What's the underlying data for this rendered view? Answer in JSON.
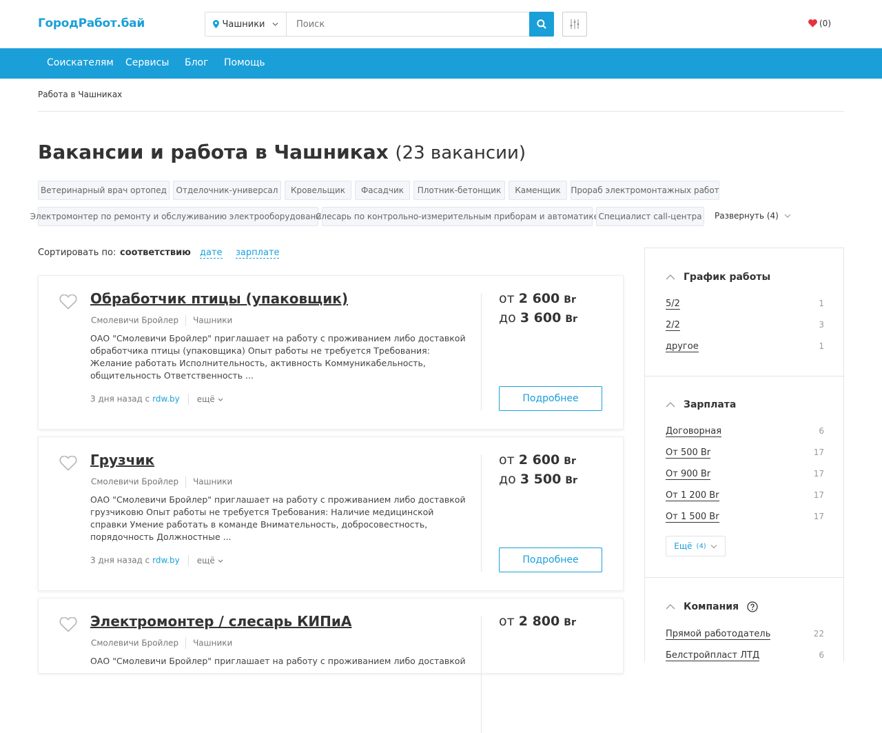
{
  "header": {
    "logo": "ГородРабот.бай",
    "city": "Чашники",
    "search_placeholder": "Поиск",
    "favorites_count": "(0)"
  },
  "nav": [
    "Соискателям",
    "Сервисы",
    "Блог",
    "Помощь"
  ],
  "breadcrumb": "Работа в Чашниках",
  "page": {
    "title": "Вакансии и работа в Чашниках",
    "count": "(23 вакансии)"
  },
  "tags": [
    "Ветеринарный врач ортопед",
    "Отделочник-универсал",
    "Кровельщик",
    "Фасадчик",
    "Плотник-бетонщик",
    "Каменщик",
    "Прораб электромонтажных работ",
    "Электромонтер по ремонту и обслуживанию электрооборудования",
    "Слесарь по контрольно-измерительным приборам и автоматике",
    "Специалист call-центра"
  ],
  "tags_expand": "Развернуть (4)",
  "sort": {
    "label": "Сортировать по:",
    "current": "соответствию",
    "options": [
      "дате",
      "зарплате"
    ]
  },
  "vacancies": [
    {
      "title": "Обработчик птицы (упаковщик)",
      "company": "Смолевичи Бройлер",
      "city": "Чашники",
      "description": "ОАО \"Смолевичи Бройлер\" приглашает на работу с проживанием либо доставкой обработчика птицы (упаковщика) Опыт работы не требуется Требования: Желание работать Исполнительность, активность Коммуникабельность, общительность Ответственность ...",
      "posted": "3 дня назад с",
      "source": "rdw.by",
      "more": "ещё",
      "salary_from": "2 600",
      "salary_to": "3 600",
      "from_label": "от",
      "to_label": "до",
      "currency": "Br",
      "details": "Подробнее"
    },
    {
      "title": "Грузчик",
      "company": "Смолевичи Бройлер",
      "city": "Чашники",
      "description": "ОАО \"Смолевичи Бройлер\" приглашает на работу с проживанием либо доставкой грузчиковю Опыт работы не требуется Требования: Наличие медицинской справки Умение работать в команде Внимательность, добросовестность, порядочность Должностные ...",
      "posted": "3 дня назад с",
      "source": "rdw.by",
      "more": "ещё",
      "salary_from": "2 600",
      "salary_to": "3 500",
      "from_label": "от",
      "to_label": "до",
      "currency": "Br",
      "details": "Подробнее"
    },
    {
      "title": "Электромонтер / слесарь КИПиА",
      "company": "Смолевичи Бройлер",
      "city": "Чашники",
      "description": "ОАО \"Смолевичи Бройлер\" приглашает на работу с проживанием либо доставкой",
      "salary_from": "2 800",
      "from_label": "от",
      "currency": "Br"
    }
  ],
  "filters": {
    "schedule": {
      "title": "График работы",
      "items": [
        {
          "label": "5/2",
          "count": "1"
        },
        {
          "label": "2/2",
          "count": "3"
        },
        {
          "label": "другое",
          "count": "1"
        }
      ]
    },
    "salary": {
      "title": "Зарплата",
      "items": [
        {
          "label": "Договорная",
          "count": "6"
        },
        {
          "label": "От 500 Br",
          "count": "17"
        },
        {
          "label": "От 900 Br",
          "count": "17"
        },
        {
          "label": "От 1 200 Br",
          "count": "17"
        },
        {
          "label": "От 1 500 Br",
          "count": "17"
        }
      ],
      "more_label": "Ещё",
      "more_count": "(4)"
    },
    "company": {
      "title": "Компания",
      "items": [
        {
          "label": "Прямой работодатель",
          "count": "22"
        },
        {
          "label": "Белстройпласт ЛТД",
          "count": "6"
        }
      ]
    }
  },
  "colors": {
    "accent": "#1a9fd9",
    "heart": "#e5323f"
  }
}
